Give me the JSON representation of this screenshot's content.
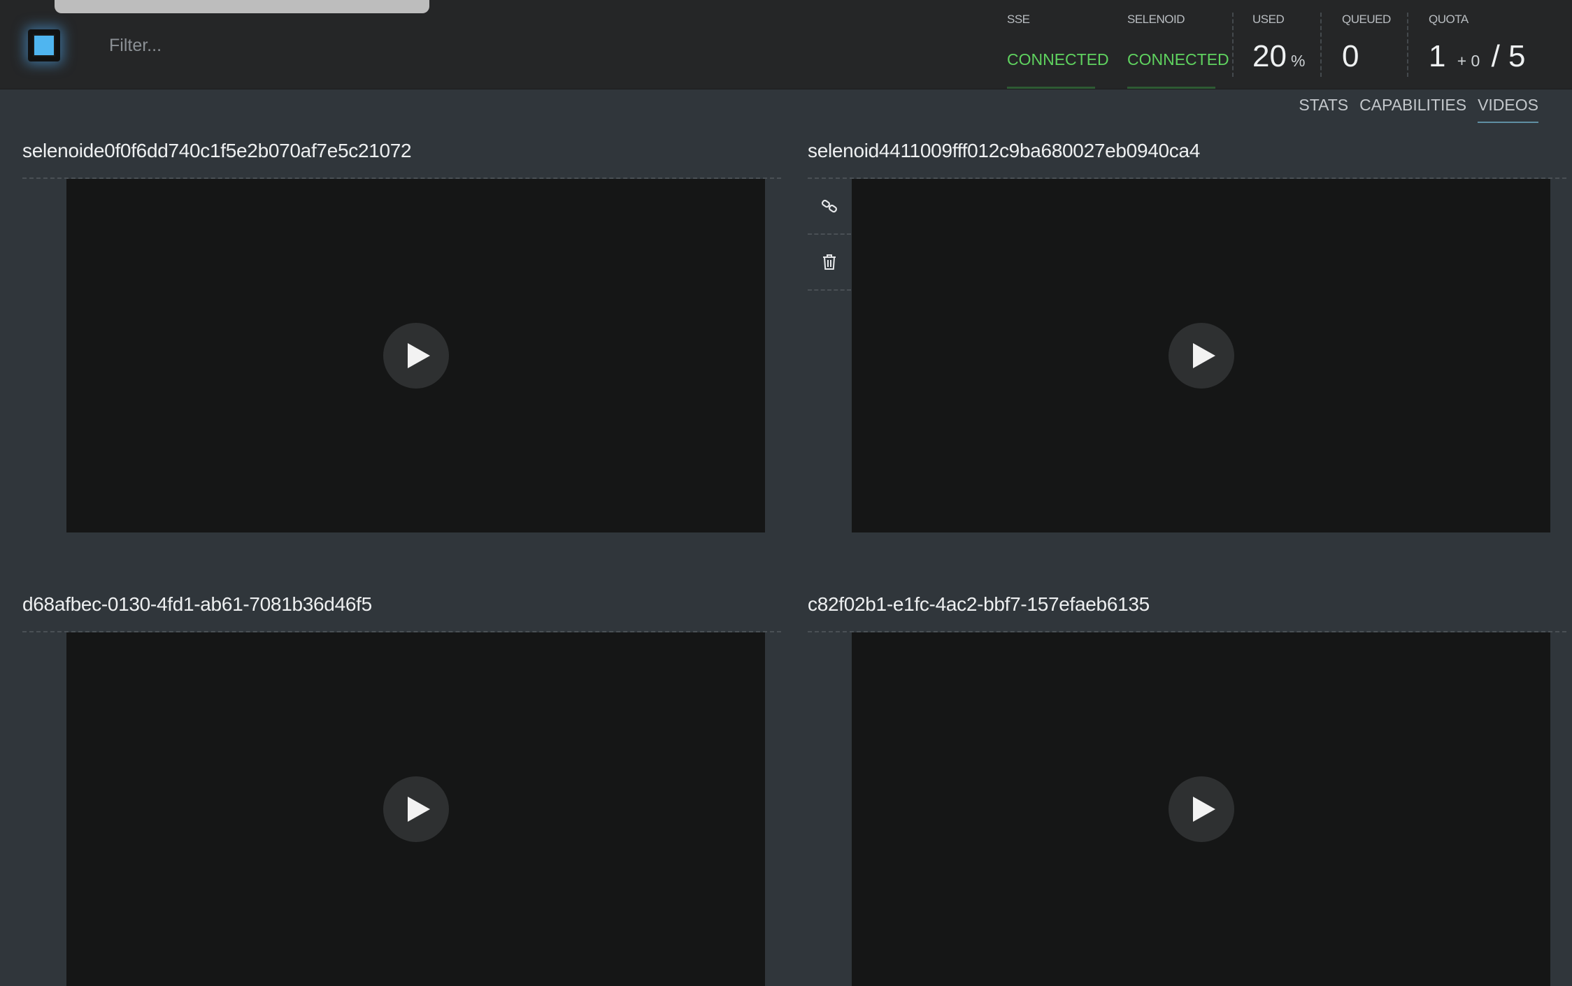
{
  "header": {
    "filter_placeholder": "Filter...",
    "sse": {
      "label": "SSE",
      "status": "CONNECTED"
    },
    "selenoid": {
      "label": "SELENOID",
      "status": "CONNECTED"
    },
    "used": {
      "label": "USED",
      "value": "20",
      "unit": "%"
    },
    "queued": {
      "label": "QUEUED",
      "value": "0"
    },
    "quota": {
      "label": "QUOTA",
      "value": "1",
      "pending": "+ 0",
      "total": "/ 5"
    }
  },
  "nav": {
    "items": [
      {
        "label": "STATS"
      },
      {
        "label": "CAPABILITIES"
      },
      {
        "label": "VIDEOS",
        "active": true
      }
    ]
  },
  "videos": [
    {
      "title": "selenoide0f0f6dd740c1f5e2b070af7e5c21072"
    },
    {
      "title": "selenoid4411009fff012c9ba680027eb0940ca4"
    },
    {
      "title": "d68afbec-0130-4fd1-ab61-7081b36d46f5"
    },
    {
      "title": "c82f02b1-e1fc-4ac2-bbf7-157efaeb6135"
    }
  ],
  "colors": {
    "connected": "#5fd25f",
    "logo": "#4fb5f0",
    "background": "#30363b",
    "header": "#252627"
  }
}
